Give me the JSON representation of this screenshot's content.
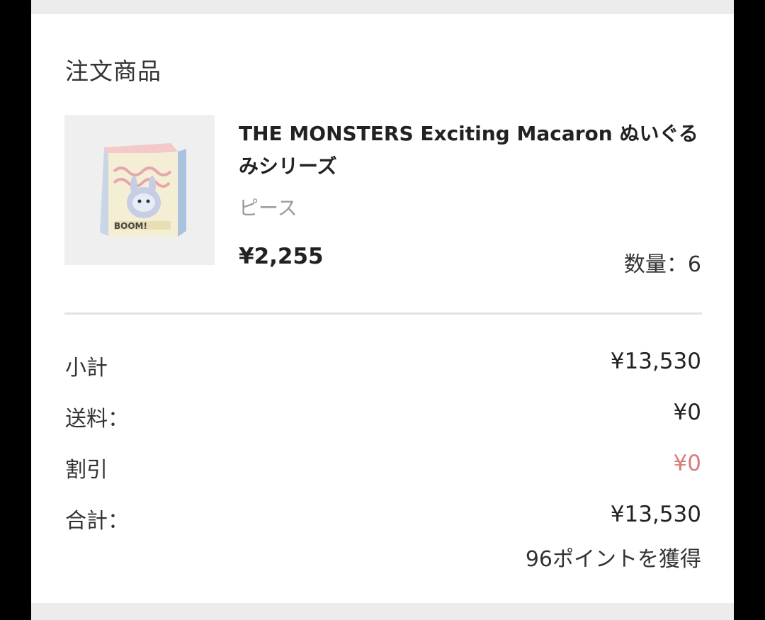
{
  "order": {
    "section_title": "注文商品",
    "product": {
      "name": "THE MONSTERS Exciting Macaron ぬいぐるみシリーズ",
      "variant": "ピース",
      "price": "¥2,255",
      "quantity": "数量：6",
      "thumbnail_icon": "product-box-image",
      "box_text": "BOOM!"
    },
    "summary": {
      "subtotal_label": "小計",
      "subtotal_value": "¥13,530",
      "shipping_label": "送料：",
      "shipping_value": "¥0",
      "discount_label": "割引",
      "discount_value": "¥0",
      "total_label": "合計：",
      "total_value": "¥13,530",
      "points_text": "96ポイントを獲得"
    }
  },
  "colors": {
    "discount": "#d97b7b",
    "secondary_text": "#9a9a9a",
    "primary_text": "#222222"
  }
}
